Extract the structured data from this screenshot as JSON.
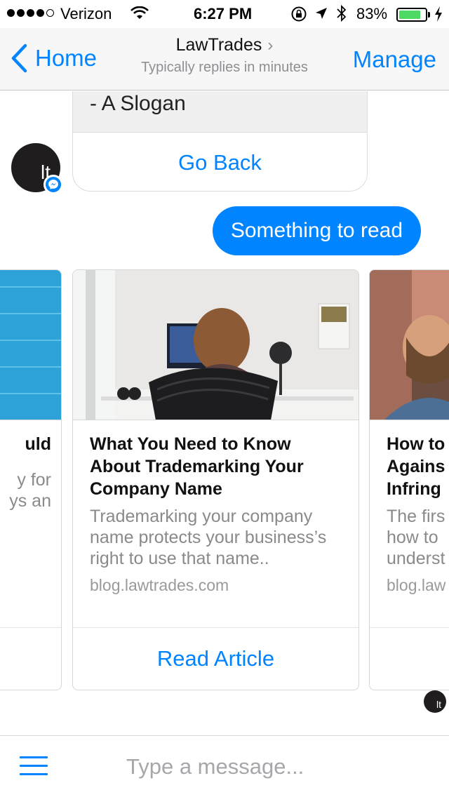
{
  "status_bar": {
    "carrier": "Verizon",
    "time": "6:27 PM",
    "battery": "83%",
    "battery_level": 0.83,
    "signal_bars": 4
  },
  "nav": {
    "back_label": "Home",
    "title": "LawTrades",
    "title_chevron": "›",
    "subtitle": "Typically replies in minutes",
    "manage_label": "Manage"
  },
  "chat": {
    "previous_card": {
      "text": "- A Slogan",
      "button": "Go Back"
    },
    "avatar_monogram": "lt",
    "user_message": "Something to read",
    "carousel": [
      {
        "title": "uld",
        "description": "y for\nys an",
        "source": "",
        "action": ""
      },
      {
        "title": "What You Need to Know About Trademarking Your Company Name",
        "description": "Trademarking your company name protects your business’s right to use that name..",
        "source": "blog.lawtrades.com",
        "action": "Read Article"
      },
      {
        "title": "How to\nAgains\nInfring",
        "description": "The firs\nhow to\nunderst",
        "source": "blog.law",
        "action": ""
      }
    ]
  },
  "composer": {
    "placeholder": "Type a message..."
  },
  "colors": {
    "accent": "#0084ff",
    "nav_background": "#f7f7f8",
    "battery": "#4cd964"
  },
  "icons": [
    "signal-dots-icon",
    "wifi-icon",
    "orientation-lock-icon",
    "location-arrow-icon",
    "bluetooth-icon",
    "battery-icon",
    "charging-bolt-icon",
    "back-chevron-icon",
    "messenger-badge-icon",
    "menu-icon"
  ]
}
